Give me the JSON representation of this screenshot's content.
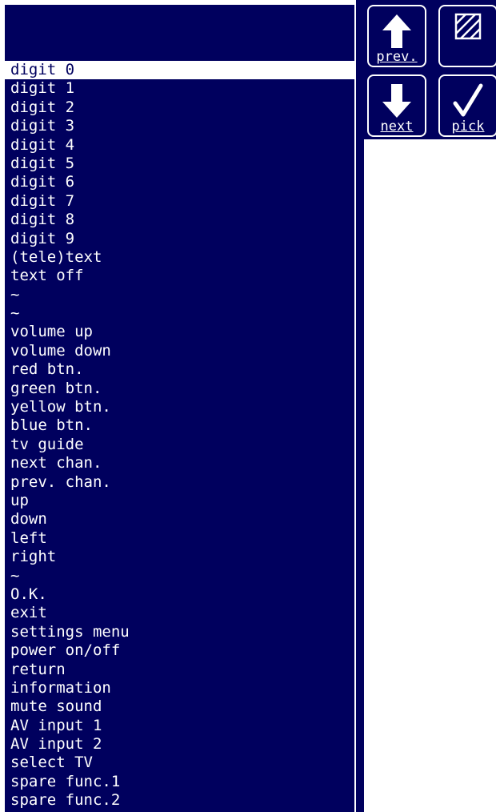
{
  "list": {
    "selected_index": 0,
    "items": [
      "digit 0",
      "digit 1",
      "digit 2",
      "digit 3",
      "digit 4",
      "digit 5",
      "digit 6",
      "digit 7",
      "digit 8",
      "digit 9",
      "(tele)text",
      "text off",
      "~",
      "~",
      "volume up",
      "volume down",
      "red btn.",
      "green btn.",
      "yellow btn.",
      "blue btn.",
      "tv guide",
      "next chan.",
      "prev. chan.",
      "up",
      "down",
      "left",
      "right",
      "~",
      "O.K.",
      "exit",
      "settings menu",
      "power on/off",
      "return",
      "information",
      "mute sound",
      "AV input 1",
      "AV input 2",
      "select TV",
      "spare func.1",
      "spare func.2"
    ]
  },
  "buttons": {
    "prev_label": "prev.",
    "next_label": "next",
    "pick_label": "pick",
    "prev_icon": "arrow-up-icon",
    "next_icon": "arrow-down-icon",
    "pick_icon": "checkmark-icon",
    "blank_icon": "hatched-square-icon"
  },
  "colors": {
    "background": "#00005e",
    "foreground": "#ffffff"
  }
}
